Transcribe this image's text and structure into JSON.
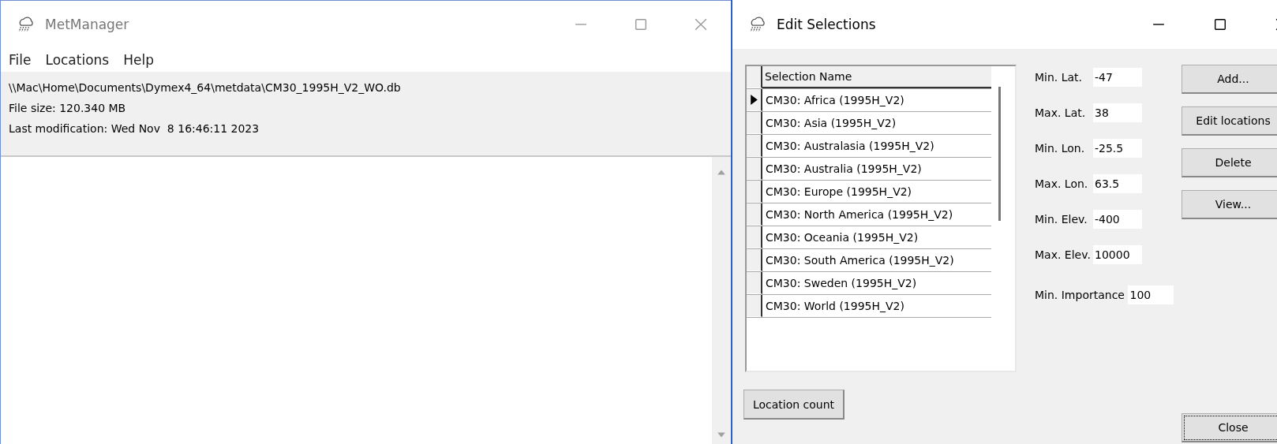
{
  "main_window": {
    "title": "MetManager",
    "active": false,
    "menu": [
      "File",
      "Locations",
      "Help"
    ],
    "info": [
      "\\\\Mac\\Home\\Documents\\Dymex4_64\\metdata\\CM30_1995H_V2_WO.db",
      "File size: 120.340 MB",
      "Last modification: Wed Nov  8 16:46:11 2023"
    ]
  },
  "dialog": {
    "title": "Edit Selections",
    "active": true,
    "grid": {
      "column": "Selection Name",
      "rows": [
        {
          "name": "CM30: Africa (1995H_V2)",
          "selected": true
        },
        {
          "name": "CM30: Asia (1995H_V2)",
          "selected": false
        },
        {
          "name": "CM30: Australasia (1995H_V2)",
          "selected": false
        },
        {
          "name": "CM30: Australia (1995H_V2)",
          "selected": false
        },
        {
          "name": "CM30: Europe (1995H_V2)",
          "selected": false
        },
        {
          "name": "CM30: North America (1995H_V2)",
          "selected": false
        },
        {
          "name": "CM30: Oceania (1995H_V2)",
          "selected": false
        },
        {
          "name": "CM30: South America (1995H_V2)",
          "selected": false
        },
        {
          "name": "CM30: Sweden (1995H_V2)",
          "selected": false
        },
        {
          "name": "CM30: World (1995H_V2)",
          "selected": false
        }
      ]
    },
    "fields": [
      {
        "label": "Min. Lat.",
        "value": "-47"
      },
      {
        "label": "Max. Lat.",
        "value": "38"
      },
      {
        "label": "Min. Lon.",
        "value": "-25.5"
      },
      {
        "label": "Max. Lon.",
        "value": "63.5"
      },
      {
        "label": "Min. Elev.",
        "value": "-400"
      },
      {
        "label": "Max. Elev.",
        "value": "10000"
      }
    ],
    "min_importance": {
      "label": "Min. Importance",
      "value": "100"
    },
    "buttons": [
      "Add...",
      "Edit locations",
      "Delete",
      "View..."
    ],
    "location_count_button": "Location count",
    "close_button": {
      "label": "Close",
      "focused": true
    }
  }
}
